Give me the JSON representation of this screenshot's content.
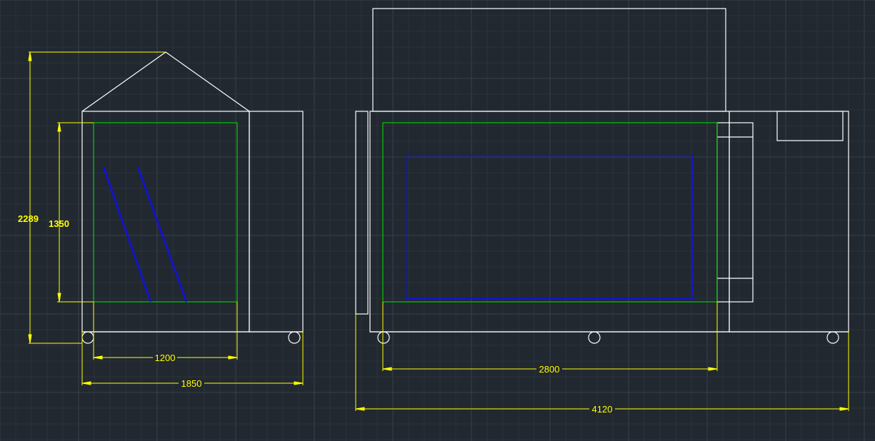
{
  "colors": {
    "background": "#212830",
    "grid_minor": "#2b323b",
    "grid_major": "#37404a",
    "outline": "#ffffff",
    "dimension": "#ffff00",
    "inner_frame": "#00cc00",
    "glass": "#1414c8"
  },
  "side_view": {
    "overall_height": "2289",
    "opening_height": "1350",
    "opening_width": "1200",
    "overall_width": "1850"
  },
  "front_view": {
    "opening_width": "2800",
    "overall_width": "4120"
  }
}
